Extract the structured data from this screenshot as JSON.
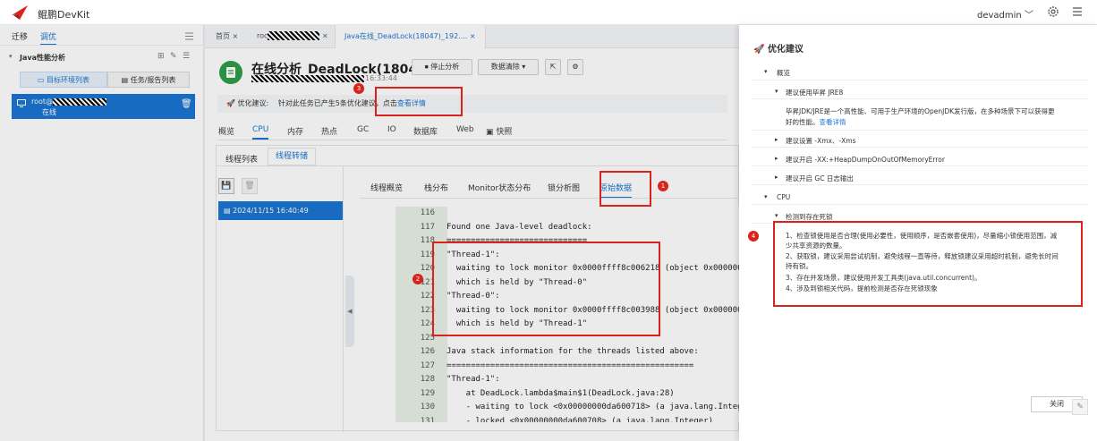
{
  "app": {
    "name": "鲲鹏DevKit",
    "user": "devadmin"
  },
  "left": {
    "tabs": [
      "迁移",
      "调优"
    ],
    "tree_title": "Java性能分析",
    "btn_targets": "目标环境列表",
    "btn_tasks": "任务/报告列表",
    "node_name": "root@",
    "node_status": "在线"
  },
  "main": {
    "tabs": [
      {
        "label": "首页"
      },
      {
        "label": "roc"
      },
      {
        "label": "Java在线_DeadLock(18047)_192...."
      }
    ],
    "title": "在线分析_DeadLock(18047)",
    "time": "16:33:44",
    "btn_stop": "停止分析",
    "btn_clear": "数据清除",
    "tip_label": "优化建议:",
    "tip_text": "针对此任务已产生5条优化建议，点击",
    "tip_link": "查看详情",
    "main_tabs": [
      "概览",
      "CPU",
      "内存",
      "热点",
      "GC",
      "IO",
      "数据库",
      "Web",
      "快照"
    ],
    "sub_tabs": [
      "线程列表",
      "线程转储"
    ],
    "date_item": "2024/11/15 16:40:49",
    "view_tabs": [
      "线程概览",
      "栈分布",
      "Monitor状态分布",
      "锁分析图",
      "原始数据"
    ],
    "code": [
      {
        "n": "116",
        "t": ""
      },
      {
        "n": "117",
        "t": "Found one Java-level deadlock:"
      },
      {
        "n": "118",
        "t": "============================="
      },
      {
        "n": "119",
        "t": "\"Thread-1\":"
      },
      {
        "n": "120",
        "t": "  waiting to lock monitor 0x0000ffff8c006218 (object 0x00000000"
      },
      {
        "n": "121",
        "t": "  which is held by \"Thread-0\""
      },
      {
        "n": "122",
        "t": "\"Thread-0\":"
      },
      {
        "n": "123",
        "t": "  waiting to lock monitor 0x0000ffff8c003988 (object 0x00000000"
      },
      {
        "n": "124",
        "t": "  which is held by \"Thread-1\""
      },
      {
        "n": "125",
        "t": ""
      },
      {
        "n": "126",
        "t": "Java stack information for the threads listed above:"
      },
      {
        "n": "127",
        "t": "==================================================="
      },
      {
        "n": "128",
        "t": "\"Thread-1\":"
      },
      {
        "n": "129",
        "t": "    at DeadLock.lambda$main$1(DeadLock.java:28)"
      },
      {
        "n": "130",
        "t": "    - waiting to lock <0x00000000da600718> (a java.lang.Integer"
      },
      {
        "n": "131",
        "t": "    - locked <0x00000000da600708> (a java.lang.Integer)"
      }
    ]
  },
  "drawer": {
    "title": "优化建议",
    "g1": "概览",
    "i1": "建议使用毕昇 JRE8",
    "i1_desc1": "毕昇JDK/JRE是一个高性能、可用于生产环境的OpenJDK发行版，在多种场景下可以获得更",
    "i1_desc2": "好的性能。",
    "i1_link": "查看详情",
    "i2": "建议设置 -Xmx、-Xms",
    "i3": "建议开启 -XX:+HeapDumpOnOutOfMemoryError",
    "i4": "建议开启 GC 日志输出",
    "g2": "CPU",
    "i5": "检测到存在死锁",
    "adv1": "1、检查锁使用是否合理(使用必要性，使用顺序，是否嵌套使用)，尽量缩小锁使用范围，减",
    "adv1b": "少共享资源的数量。",
    "adv2": "2、获取锁，建议采用尝试机制，避免线程一直等待，释放锁建议采用超时机制，避免长时间",
    "adv2b": "持有锁。",
    "adv3": "3、存在并发场景，建议使用并发工具类(java.util.concurrent)。",
    "adv4": "4、涉及到锁相关代码，提前检测是否存在死锁现象",
    "close": "关闭"
  },
  "annotations": [
    "1",
    "2",
    "3",
    "4"
  ]
}
